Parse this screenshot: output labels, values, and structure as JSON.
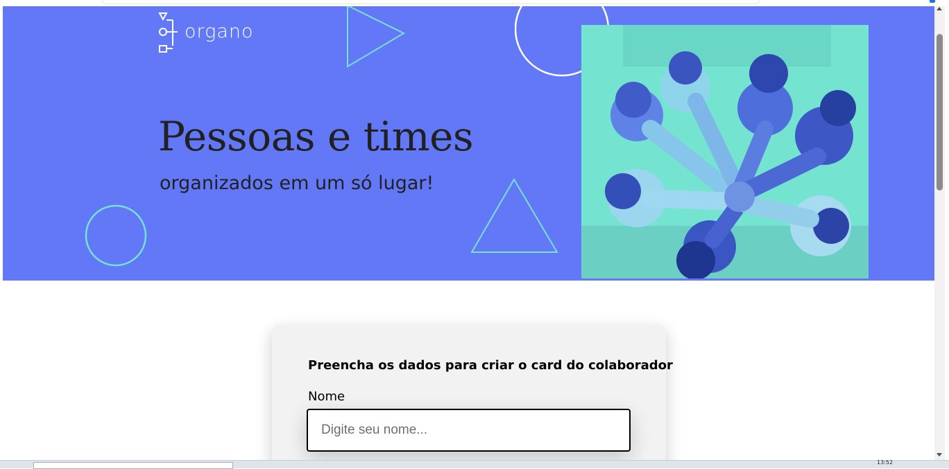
{
  "brand": {
    "name": "organo",
    "color": "#6278f7",
    "accent": "#74e3d0"
  },
  "banner": {
    "title": "Pessoas e times",
    "subtitle": "organizados em um só lugar!"
  },
  "form": {
    "title": "Preencha os dados para criar o card do colaborador",
    "name_label": "Nome",
    "name_placeholder": "Digite seu nome...",
    "name_value": ""
  },
  "taskbar": {
    "time": "13:52"
  }
}
